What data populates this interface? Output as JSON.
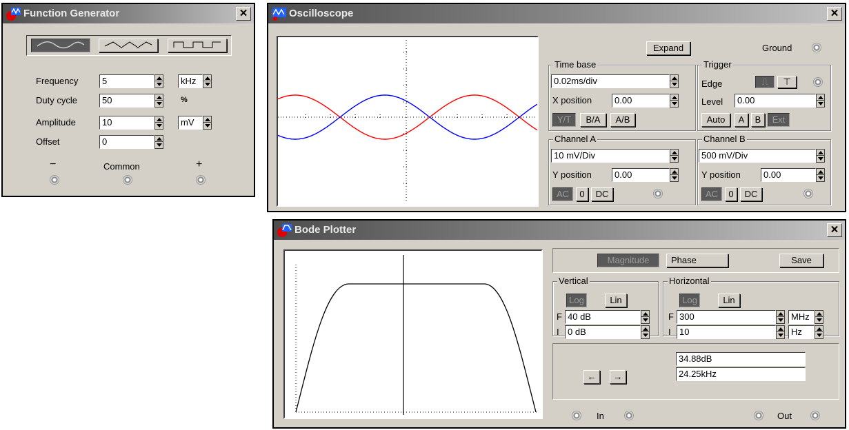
{
  "function_generator": {
    "title": "Function Generator",
    "waveforms": [
      "sine-wave-icon",
      "triangle-wave-icon",
      "square-wave-icon"
    ],
    "frequency": {
      "label": "Frequency",
      "value": "5",
      "unit": "kHz"
    },
    "duty_cycle": {
      "label": "Duty cycle",
      "value": "50",
      "unit": "%"
    },
    "amplitude": {
      "label": "Amplitude",
      "value": "10",
      "unit": "mV"
    },
    "offset": {
      "label": "Offset",
      "value": "0"
    },
    "terminals": {
      "minus": "−",
      "common": "Common",
      "plus": "+"
    }
  },
  "oscilloscope": {
    "title": "Oscilloscope",
    "expand_label": "Expand",
    "ground_label": "Ground",
    "time_base": {
      "label": "Time base",
      "value": "0.02ms/div",
      "x_position_label": "X position",
      "x_position": "0.00",
      "modes": [
        "Y/T",
        "B/A",
        "A/B"
      ]
    },
    "trigger": {
      "label": "Trigger",
      "edge_label": "Edge",
      "level_label": "Level",
      "level": "0.00",
      "modes": [
        "Auto",
        "A",
        "B",
        "Ext"
      ]
    },
    "channel_a": {
      "label": "Channel A",
      "scale": "10 mV/Div",
      "y_position_label": "Y position",
      "y_position": "0.00",
      "coupling": [
        "AC",
        "0",
        "DC"
      ]
    },
    "channel_b": {
      "label": "Channel B",
      "scale": "500 mV/Div",
      "y_position_label": "Y position",
      "y_position": "0.00",
      "coupling": [
        "AC",
        "0",
        "DC"
      ]
    },
    "trace_colors": {
      "channel_a": "#ff0000",
      "channel_b": "#0000ff"
    }
  },
  "bode_plotter": {
    "title": "Bode Plotter",
    "magnitude_label": "Magnitude",
    "phase_label": "Phase",
    "save_label": "Save",
    "vertical": {
      "label": "Vertical",
      "log": "Log",
      "lin": "Lin",
      "f_label": "F",
      "f_value": "40 dB",
      "i_label": "I",
      "i_value": "0 dB"
    },
    "horizontal": {
      "label": "Horizontal",
      "log": "Log",
      "lin": "Lin",
      "f_label": "F",
      "f_value": "300",
      "f_unit": "MHz",
      "i_label": "I",
      "i_value": "10",
      "i_unit": "Hz"
    },
    "readout_db": "34.88dB",
    "readout_freq": "24.25kHz",
    "in_label": "In",
    "out_label": "Out"
  }
}
